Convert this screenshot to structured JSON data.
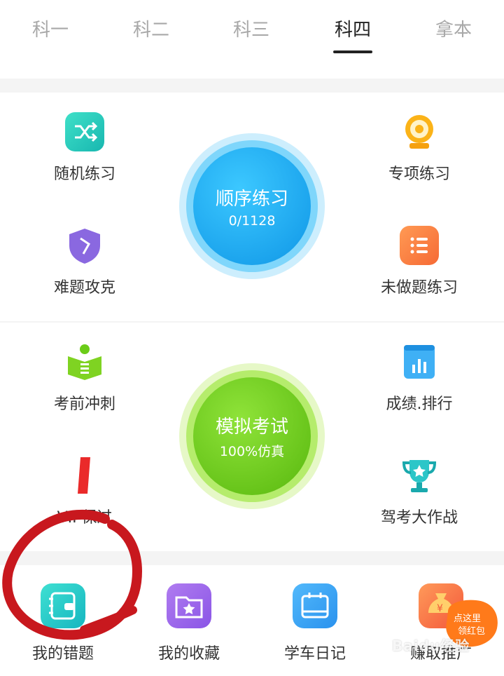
{
  "tabs": [
    {
      "label": "科一"
    },
    {
      "label": "科二"
    },
    {
      "label": "科三"
    },
    {
      "label": "科四",
      "active": true
    },
    {
      "label": "拿本"
    }
  ],
  "practice": {
    "random": "随机练习",
    "special": "专项练习",
    "hard": "难题攻克",
    "undone": "未做题练习",
    "sequential_title": "顺序练习",
    "sequential_progress": "0/1128"
  },
  "exam": {
    "sprint": "考前冲刺",
    "ranking": "成绩.排行",
    "vip": "VIP保过",
    "battle": "驾考大作战",
    "mock_title": "模拟考试",
    "mock_sub": "100%仿真"
  },
  "bottom": {
    "mistakes": "我的错题",
    "favorites": "我的收藏",
    "diary": "学车日记",
    "earn": "赚取推广"
  },
  "badge_text": "点这里领红包",
  "watermark": "Baidu经验",
  "colors": {
    "sequential": "#1aa6f0",
    "mock": "#6bcc19",
    "scribble": "#c8181e"
  }
}
